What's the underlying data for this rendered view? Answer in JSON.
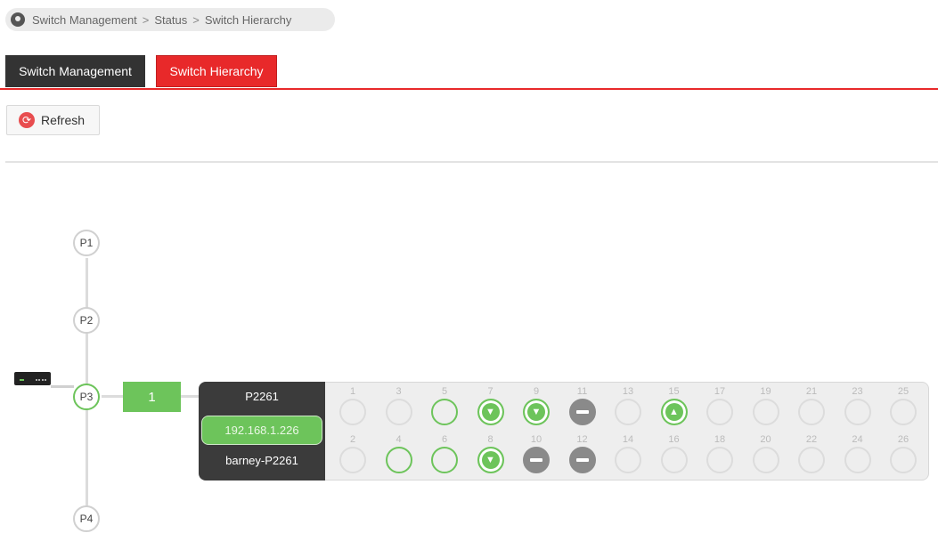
{
  "breadcrumb": {
    "items": [
      "Switch Management",
      "Status",
      "Switch Hierarchy"
    ],
    "separator": ">"
  },
  "tabs": [
    {
      "label": "Switch Management",
      "active": false
    },
    {
      "label": "Switch Hierarchy",
      "active": true
    }
  ],
  "toolbar": {
    "refresh_label": "Refresh"
  },
  "hierarchy": {
    "ports": [
      "P1",
      "P2",
      "P3",
      "P4"
    ],
    "active_port": "P3",
    "link_count": "1"
  },
  "switch": {
    "model": "P2261",
    "ip": "192.168.1.226",
    "hostname": "barney-P2261",
    "ports_top": [
      {
        "num": "1",
        "state": "empty"
      },
      {
        "num": "3",
        "state": "empty"
      },
      {
        "num": "5",
        "state": "up"
      },
      {
        "num": "7",
        "state": "link-down",
        "glyph": "▼"
      },
      {
        "num": "9",
        "state": "link-down",
        "glyph": "▼"
      },
      {
        "num": "11",
        "state": "blocked"
      },
      {
        "num": "13",
        "state": "empty"
      },
      {
        "num": "15",
        "state": "link-up",
        "glyph": "▲"
      },
      {
        "num": "17",
        "state": "empty"
      },
      {
        "num": "19",
        "state": "empty"
      },
      {
        "num": "21",
        "state": "empty"
      },
      {
        "num": "23",
        "state": "empty"
      },
      {
        "num": "25",
        "state": "empty"
      }
    ],
    "ports_bottom": [
      {
        "num": "2",
        "state": "empty"
      },
      {
        "num": "4",
        "state": "up"
      },
      {
        "num": "6",
        "state": "up"
      },
      {
        "num": "8",
        "state": "link-down",
        "glyph": "▼"
      },
      {
        "num": "10",
        "state": "blocked"
      },
      {
        "num": "12",
        "state": "blocked"
      },
      {
        "num": "14",
        "state": "empty"
      },
      {
        "num": "16",
        "state": "empty"
      },
      {
        "num": "18",
        "state": "empty"
      },
      {
        "num": "20",
        "state": "empty"
      },
      {
        "num": "22",
        "state": "empty"
      },
      {
        "num": "24",
        "state": "empty"
      },
      {
        "num": "26",
        "state": "empty"
      }
    ]
  },
  "colors": {
    "accent_red": "#e8292a",
    "link_green": "#6dc45b",
    "blocked_gray": "#8a8a8a",
    "tab_dark": "#333333"
  },
  "icons": {
    "breadcrumb": "location-pin-icon",
    "refresh": "refresh-icon",
    "device": "switch-device-icon"
  }
}
